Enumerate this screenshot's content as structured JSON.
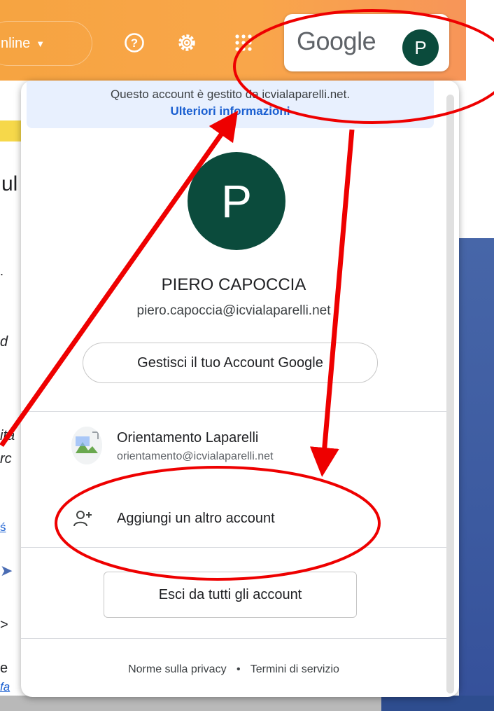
{
  "background": {
    "status_label": "nline",
    "text_fragments": [
      "ul",
      ".",
      " d",
      "ita",
      "rc",
      "ś",
      ">",
      "e",
      "fa"
    ]
  },
  "toolbar": {
    "help_icon": "help-circle-icon",
    "settings_icon": "gear-icon",
    "apps_icon": "apps-grid-icon",
    "google_label": "Google",
    "avatar_letter": "P"
  },
  "popup": {
    "managed_notice": "Questo account è gestito da icvialaparelli.net.",
    "managed_link": "Ulteriori informazioni",
    "avatar_letter": "P",
    "user_name": "PIERO CAPOCCIA",
    "user_email": "piero.capoccia@icvialaparelli.net",
    "manage_button": "Gestisci il tuo Account Google",
    "other_account": {
      "name": "Orientamento Laparelli",
      "email": "orientamento@icvialaparelli.net"
    },
    "add_account": "Aggiungi un altro account",
    "sign_out_all": "Esci da tutti gli account",
    "privacy_link": "Norme sulla privacy",
    "separator": "•",
    "terms_link": "Termini di servizio"
  },
  "colors": {
    "topbar": "#f6a441",
    "avatar": "#0b4b3c",
    "managed_bg": "#e8f0fe",
    "link": "#1a5fd1",
    "annotation": "#ee0000"
  }
}
